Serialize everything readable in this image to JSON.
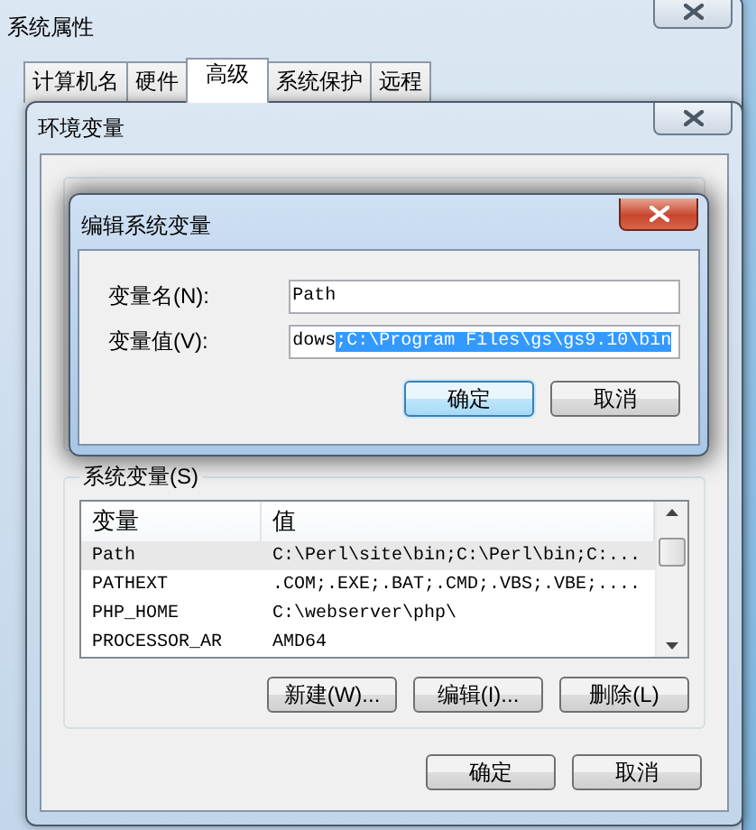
{
  "system_properties": {
    "title": "系统属性",
    "active": false,
    "tabs": [
      {
        "label": "计算机名",
        "selected": false
      },
      {
        "label": "硬件",
        "selected": false
      },
      {
        "label": "高级",
        "selected": true
      },
      {
        "label": "系统保护",
        "selected": false
      },
      {
        "label": "远程",
        "selected": false
      }
    ]
  },
  "environment_variables": {
    "title": "环境变量",
    "active": false,
    "system_variables": {
      "label": "系统变量(S)",
      "columns": [
        "变量",
        "值"
      ],
      "rows": [
        {
          "name": "Path",
          "value": "C:\\Perl\\site\\bin;C:\\Perl\\bin;C:...",
          "selected": true
        },
        {
          "name": "PATHEXT",
          "value": ".COM;.EXE;.BAT;.CMD;.VBS;.VBE;....",
          "selected": false
        },
        {
          "name": "PHP_HOME",
          "value": "C:\\webserver\\php\\",
          "selected": false
        },
        {
          "name": "PROCESSOR_AR",
          "value": "AMD64",
          "selected": false
        }
      ]
    },
    "list_buttons": [
      "新建(W)...",
      "编辑(I)...",
      "删除(L)"
    ],
    "buttons": [
      "确定",
      "取消"
    ]
  },
  "edit_system_variable": {
    "title": "编辑系统变量",
    "active": true,
    "fields": [
      {
        "label": "变量名(N):",
        "value": "Path"
      },
      {
        "label": "变量值(V):",
        "value": "dows",
        "selected_text": ";C:\\Program Files\\gs\\gs9.10\\bin"
      }
    ],
    "buttons": [
      {
        "label": "确定",
        "default": true
      },
      {
        "label": "取消",
        "default": false
      }
    ]
  }
}
